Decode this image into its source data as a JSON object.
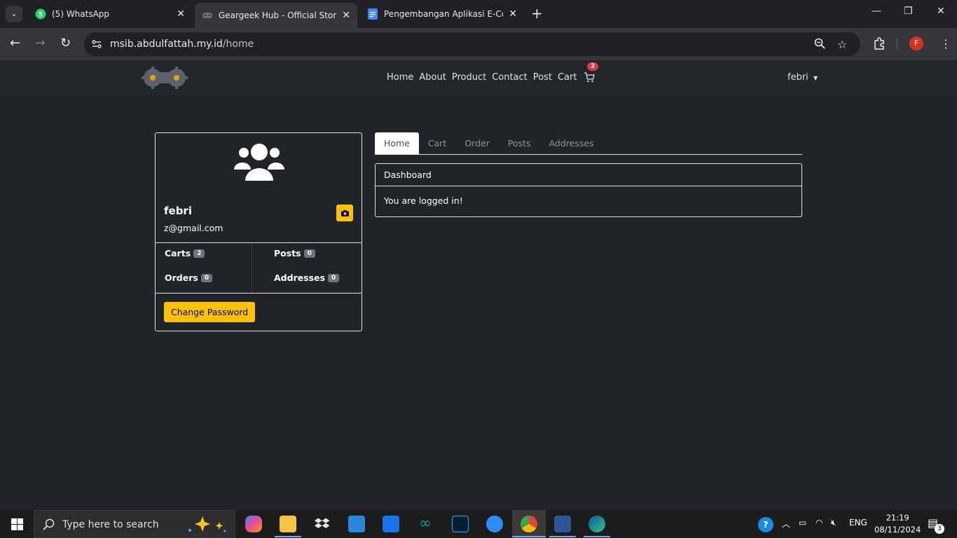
{
  "browser": {
    "tabs": [
      {
        "title": "(5) WhatsApp",
        "badge": "5"
      },
      {
        "title": "Geargeek Hub - Official Store"
      },
      {
        "title": "Pengembangan Aplikasi E-Com"
      }
    ],
    "url_domain": "msib.abdulfattah.my.id",
    "url_path": "/home",
    "profile_initial": "F"
  },
  "site": {
    "nav": [
      "Home",
      "About",
      "Product",
      "Contact",
      "Post"
    ],
    "cart_label": "Cart",
    "cart_count": "2",
    "user_name": "febri"
  },
  "profile": {
    "name": "febri",
    "email": "z@gmail.com",
    "stats": [
      {
        "label": "Carts",
        "count": "2"
      },
      {
        "label": "Posts",
        "count": "0"
      },
      {
        "label": "Orders",
        "count": "0"
      },
      {
        "label": "Addresses",
        "count": "0"
      }
    ],
    "change_password": "Change Password"
  },
  "tabs": [
    "Home",
    "Cart",
    "Order",
    "Posts",
    "Addresses"
  ],
  "dashboard": {
    "title": "Dashboard",
    "message": "You are logged in!"
  },
  "taskbar": {
    "search_placeholder": "Type here to search",
    "lang": "ENG",
    "time": "21:19",
    "date": "08/11/2024",
    "notif_count": "3"
  }
}
